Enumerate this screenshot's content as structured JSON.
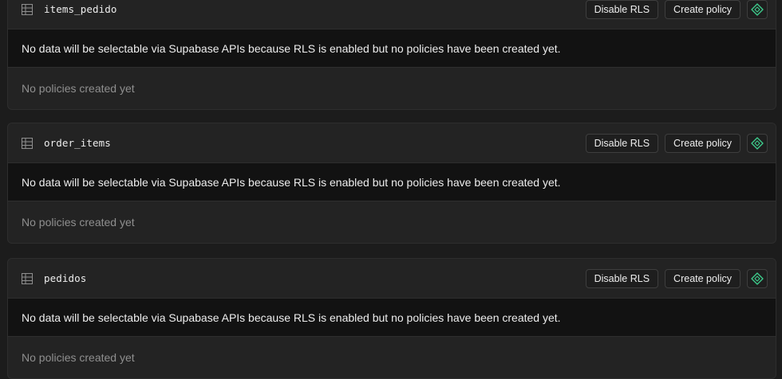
{
  "tables": [
    {
      "name": "items_pedido",
      "disable_label": "Disable RLS",
      "create_label": "Create policy",
      "warning": "No data will be selectable via Supabase APIs because RLS is enabled but no policies have been created yet.",
      "empty": "No policies created yet"
    },
    {
      "name": "order_items",
      "disable_label": "Disable RLS",
      "create_label": "Create policy",
      "warning": "No data will be selectable via Supabase APIs because RLS is enabled but no policies have been created yet.",
      "empty": "No policies created yet"
    },
    {
      "name": "pedidos",
      "disable_label": "Disable RLS",
      "create_label": "Create policy",
      "warning": "No data will be selectable via Supabase APIs because RLS is enabled but no policies have been created yet.",
      "empty": "No policies created yet"
    }
  ],
  "icons": {
    "table": "table-icon",
    "policy_assistant": "diamond-sparkle-icon"
  },
  "colors": {
    "background": "#1c1c1c",
    "card": "#232323",
    "warning_row": "#121212",
    "accent_green": "#3ecf8e",
    "muted_text": "#8f8f8f"
  }
}
